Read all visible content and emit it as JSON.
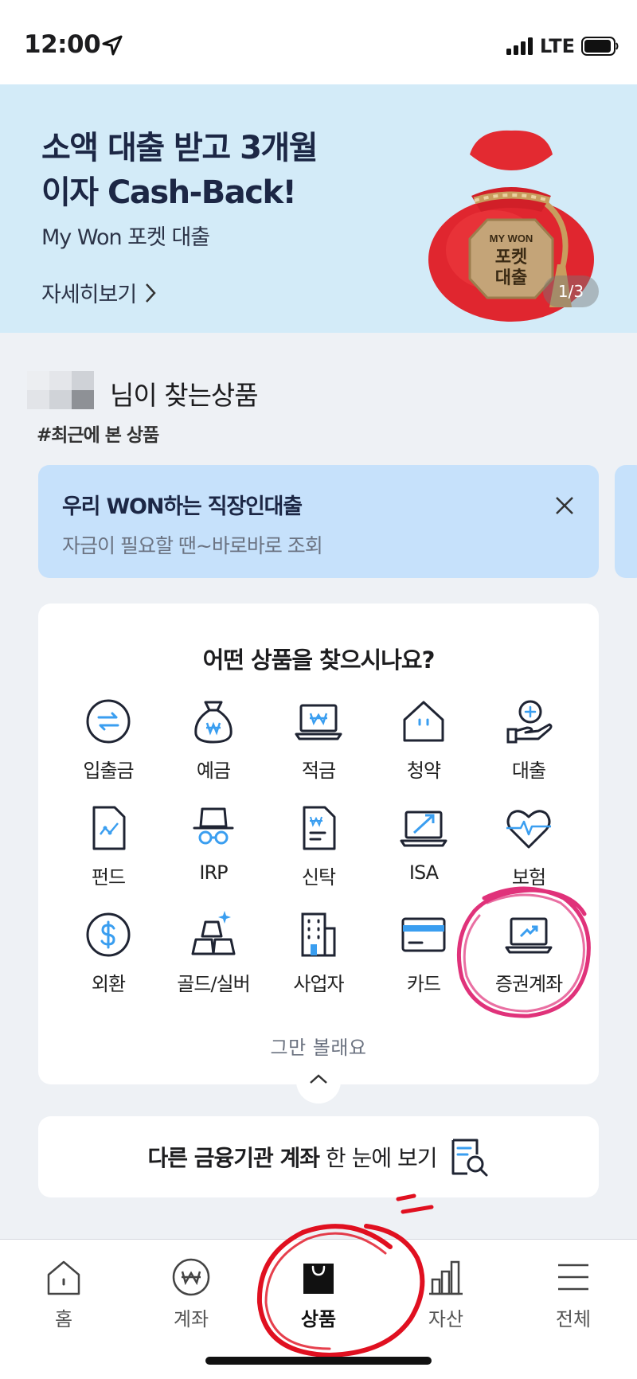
{
  "status_bar": {
    "time": "12:00",
    "network": "LTE"
  },
  "banner": {
    "title": "소액 대출 받고 3개월\n이자 Cash-Back!",
    "subtitle": "My Won 포켓 대출",
    "more_label": "자세히보기",
    "pouch_label_top": "MY WON",
    "pouch_label_main1": "포켓",
    "pouch_label_main2": "대출",
    "pager": "1/3"
  },
  "recommend": {
    "title": "님이 찾는상품",
    "tag": "#최근에 본 상품",
    "card": {
      "title": "우리 WON하는 직장인대출",
      "desc": "자금이 필요할 땐~바로바로 조회"
    }
  },
  "products": {
    "title": "어떤 상품을 찾으시나요?",
    "items": [
      {
        "label": "입출금",
        "icon": "transfer-icon"
      },
      {
        "label": "예금",
        "icon": "money-bag-icon"
      },
      {
        "label": "적금",
        "icon": "laptop-won-icon"
      },
      {
        "label": "청약",
        "icon": "house-icon"
      },
      {
        "label": "대출",
        "icon": "loan-hand-icon"
      },
      {
        "label": "펀드",
        "icon": "fund-doc-icon"
      },
      {
        "label": "IRP",
        "icon": "retirement-icon"
      },
      {
        "label": "신탁",
        "icon": "trust-doc-icon"
      },
      {
        "label": "ISA",
        "icon": "isa-laptop-icon"
      },
      {
        "label": "보험",
        "icon": "heart-icon"
      },
      {
        "label": "외환",
        "icon": "dollar-icon"
      },
      {
        "label": "골드/실버",
        "icon": "gold-bar-icon"
      },
      {
        "label": "사업자",
        "icon": "building-icon"
      },
      {
        "label": "카드",
        "icon": "card-icon"
      },
      {
        "label": "증권계좌",
        "icon": "stock-laptop-icon"
      }
    ],
    "collapse_label": "그만 볼래요"
  },
  "other_accounts": {
    "bold": "다른 금융기관 계좌",
    "rest": " 한 눈에 보기"
  },
  "tabbar": {
    "tabs": [
      {
        "label": "홈"
      },
      {
        "label": "계좌"
      },
      {
        "label": "상품"
      },
      {
        "label": "자산"
      },
      {
        "label": "전체"
      }
    ],
    "active_index": 2
  },
  "colors": {
    "accent_blue": "#3a9ef0",
    "banner_bg": "#d3ebf8",
    "rec_card_bg": "#c6e1fb",
    "annotation_pink": "#e0327a",
    "annotation_red": "#e01020"
  }
}
